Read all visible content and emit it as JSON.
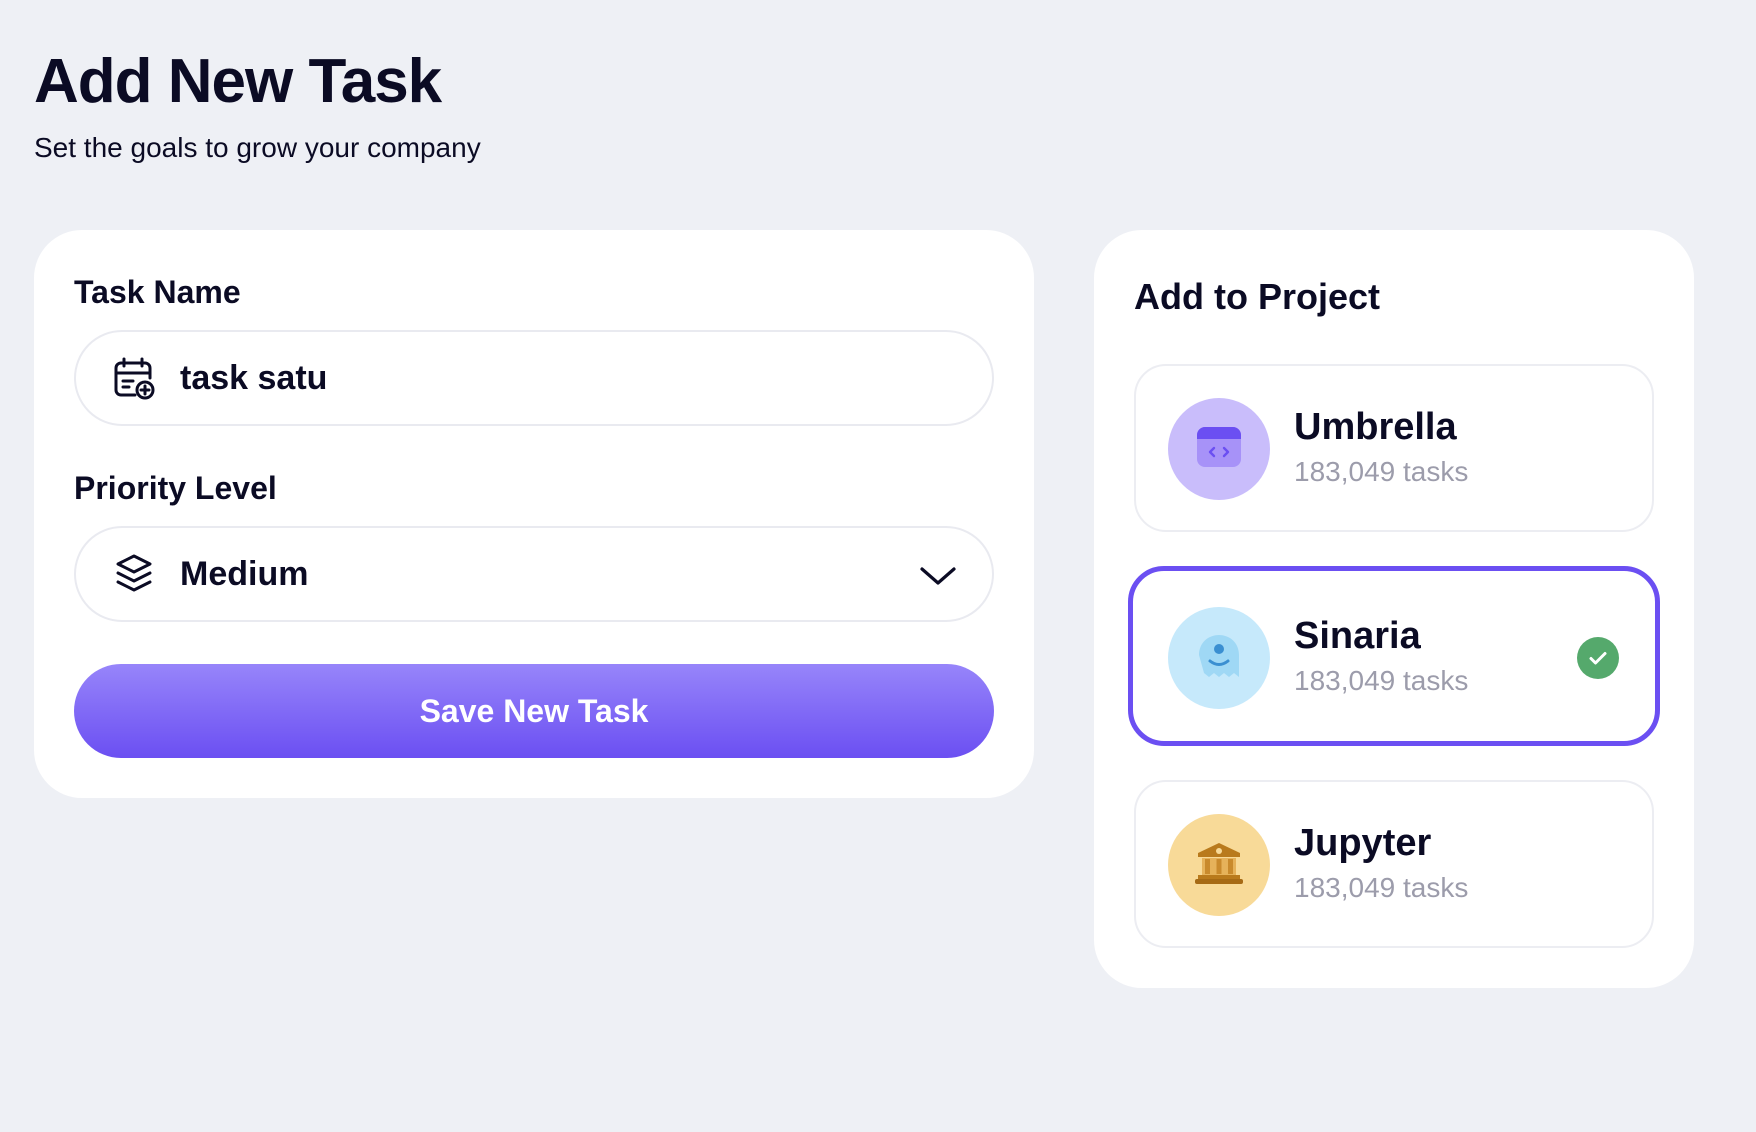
{
  "header": {
    "title": "Add New Task",
    "subtitle": "Set the goals to grow your company"
  },
  "form": {
    "task_name_label": "Task Name",
    "task_name_value": "task satu",
    "task_icon": "calendar-add-icon",
    "priority_label": "Priority Level",
    "priority_value": "Medium",
    "priority_icon": "layers-icon",
    "save_label": "Save New Task"
  },
  "projects": {
    "heading": "Add to Project",
    "items": [
      {
        "name": "Umbrella",
        "count": "183,049 tasks",
        "icon": "code-window-icon",
        "color": "#C9BDFB",
        "selected": false
      },
      {
        "name": "Sinaria",
        "count": "183,049 tasks",
        "icon": "ghost-icon",
        "color": "#C6E9FB",
        "selected": true
      },
      {
        "name": "Jupyter",
        "count": "183,049 tasks",
        "icon": "bank-icon",
        "color": "#F8DA98",
        "selected": false
      }
    ]
  },
  "colors": {
    "accent": "#6B4FF2",
    "background": "#EEF0F5",
    "check": "#55A96C"
  }
}
